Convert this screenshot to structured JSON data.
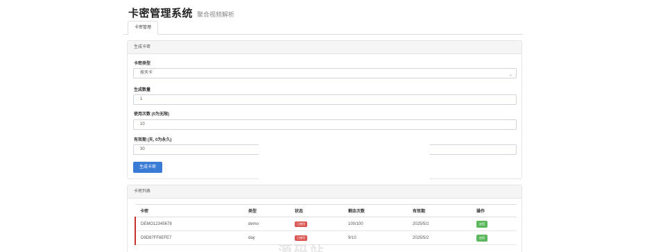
{
  "header": {
    "title": "卡密管理系统",
    "subtitle": "聚合视频解析"
  },
  "tabs": [
    {
      "label": "卡密管理"
    }
  ],
  "generate": {
    "heading": "生成卡密",
    "type_label": "卡密类型",
    "type_value": "按天卡",
    "count_label": "生成数量",
    "count_value": "1",
    "uses_label": "使用次数 (0为无限)",
    "uses_value": "10",
    "validity_label": "有效期 (天, 0为永久)",
    "validity_value": "30",
    "submit_label": "生成卡密"
  },
  "list": {
    "heading": "卡密列表",
    "columns": [
      "卡密",
      "类型",
      "状态",
      "剩余次数",
      "有效期",
      "操作"
    ],
    "rows": [
      {
        "key": "DEMO12345678",
        "type": "demo",
        "status": "已使用",
        "remaining": "100/100",
        "expiry": "2025/5/2",
        "action": "启用"
      },
      {
        "key": "D9D87FF8EFE7",
        "type": "day",
        "status": "已使用",
        "remaining": "9/10",
        "expiry": "2025/5/2",
        "action": "启用"
      }
    ]
  },
  "watermark": "源码站",
  "colors": {
    "primary": "#3a7bd5",
    "danger": "#d9534f",
    "success": "#5cb85c",
    "row_accent": "#c9302c"
  }
}
